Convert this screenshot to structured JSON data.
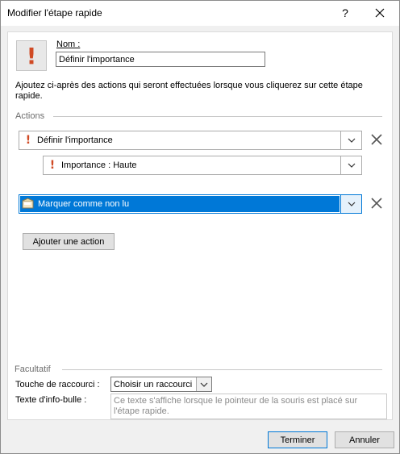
{
  "window": {
    "title": "Modifier l'étape rapide",
    "help_glyph": "?",
    "close_glyph": "✕"
  },
  "header": {
    "icon_glyph": "!",
    "name_label": "Nom :",
    "name_value": "Définir l'importance"
  },
  "description": "Ajoutez ci-après des actions qui seront effectuées lorsque vous cliquerez sur cette étape rapide.",
  "actions": {
    "section_label": "Actions",
    "items": [
      {
        "label": "Définir l'importance",
        "icon": "exclamation-icon"
      },
      {
        "label": "Importance : Haute",
        "icon": "exclamation-icon"
      },
      {
        "label": "Marquer comme non lu",
        "icon": "mail-unread-icon"
      }
    ],
    "add_button": "Ajouter une action"
  },
  "optional": {
    "section_label": "Facultatif",
    "shortcut_label": "Touche de raccourci :",
    "shortcut_value": "Choisir un raccourci",
    "tooltip_label": "Texte d'info-bulle :",
    "tooltip_placeholder": "Ce texte s'affiche lorsque le pointeur de la souris est placé sur l'étape rapide."
  },
  "footer": {
    "finish_button": "Terminer",
    "cancel_button": "Annuler"
  },
  "colors": {
    "accent": "#0078d7",
    "exclamation": "#d04a24"
  }
}
